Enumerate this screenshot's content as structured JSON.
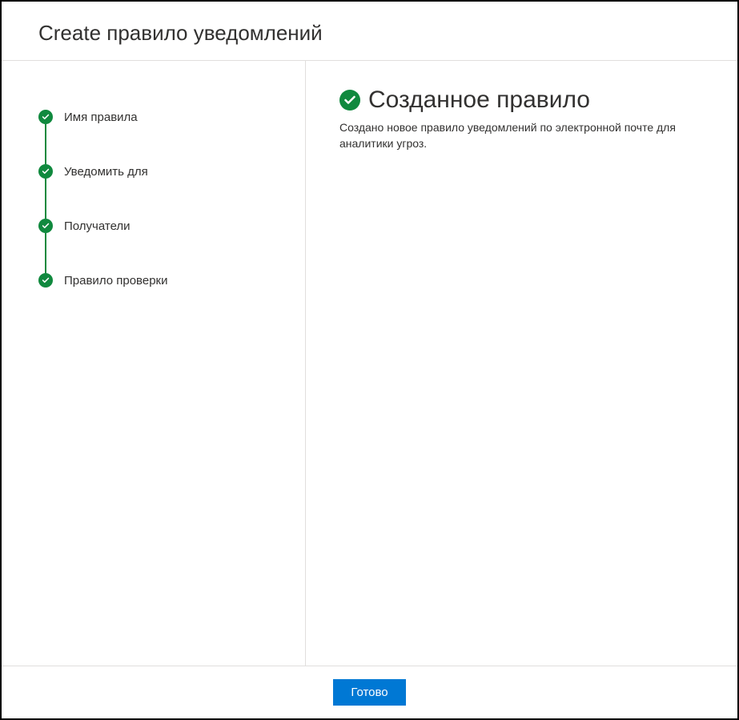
{
  "dialog": {
    "title": "Create правило уведомлений"
  },
  "steps": [
    {
      "label": "Имя правила"
    },
    {
      "label": "Уведомить для"
    },
    {
      "label": "Получатели"
    },
    {
      "label": "Правило проверки"
    }
  ],
  "result": {
    "title": "Созданное правило",
    "description": "Создано новое правило уведомлений по электронной почте для аналитики угроз."
  },
  "footer": {
    "done_label": "Готово"
  }
}
